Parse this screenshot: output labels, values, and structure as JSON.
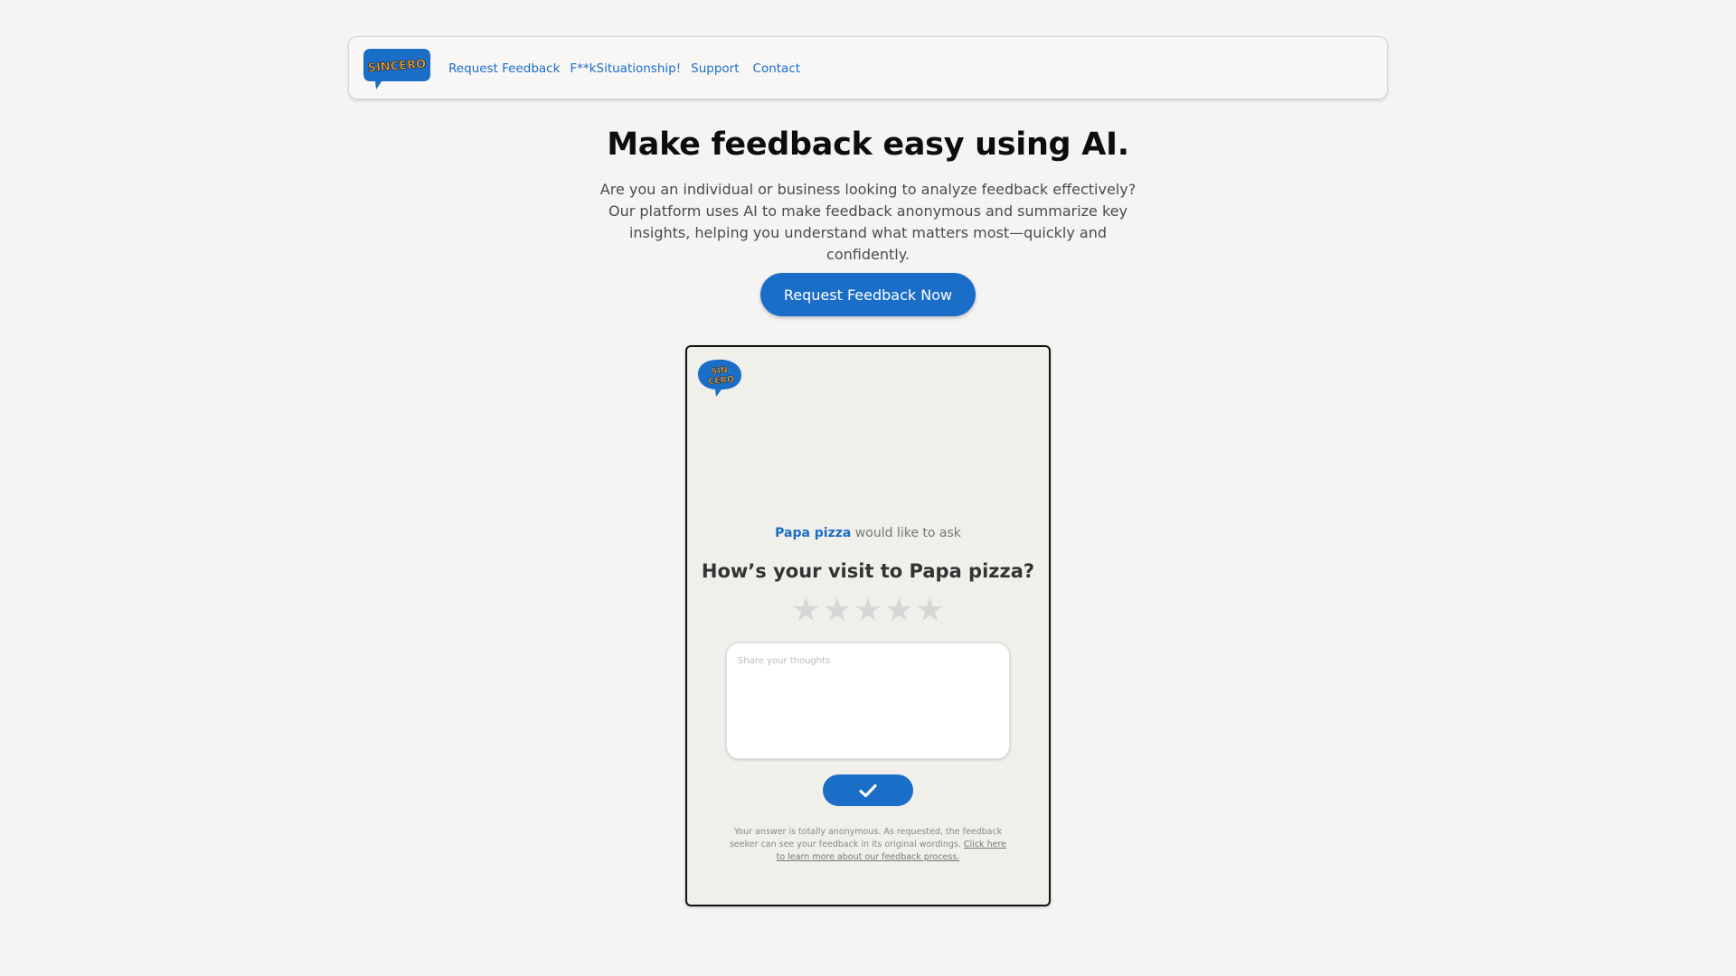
{
  "navbar": {
    "logo_text": "SINCERO",
    "links": [
      "Request Feedback",
      "F**kSituationship!",
      "Support",
      "Contact"
    ]
  },
  "hero": {
    "title": "Make feedback easy using AI.",
    "subtitle": "Are you an individual or business looking to analyze feedback effectively? Our platform uses AI to make feedback anonymous and summarize key insights, helping you understand what matters most—quickly and confidently.",
    "cta_label": "Request Feedback Now"
  },
  "preview": {
    "logo_text_line1": "SIN",
    "logo_text_line2": "CERO",
    "company": "Papa pizza",
    "asker_suffix": " would like to ask",
    "question": "How’s your visit to Papa pizza?",
    "rating": {
      "value": 0,
      "max": 5
    },
    "textarea_placeholder": "Share your thoughts",
    "submit_icon": "checkmark-icon",
    "disclaimer_text": "Your answer is totally anonymous. As requested, the feedback seeker can see your feedback in its original wordings. ",
    "disclaimer_link": "Click here to learn more about our feedback process."
  },
  "colors": {
    "brand_blue": "#1a6ec8",
    "page_bg": "#f5f4f3",
    "card_bg": "#f0efea",
    "logo_orange": "#f3a33a"
  }
}
